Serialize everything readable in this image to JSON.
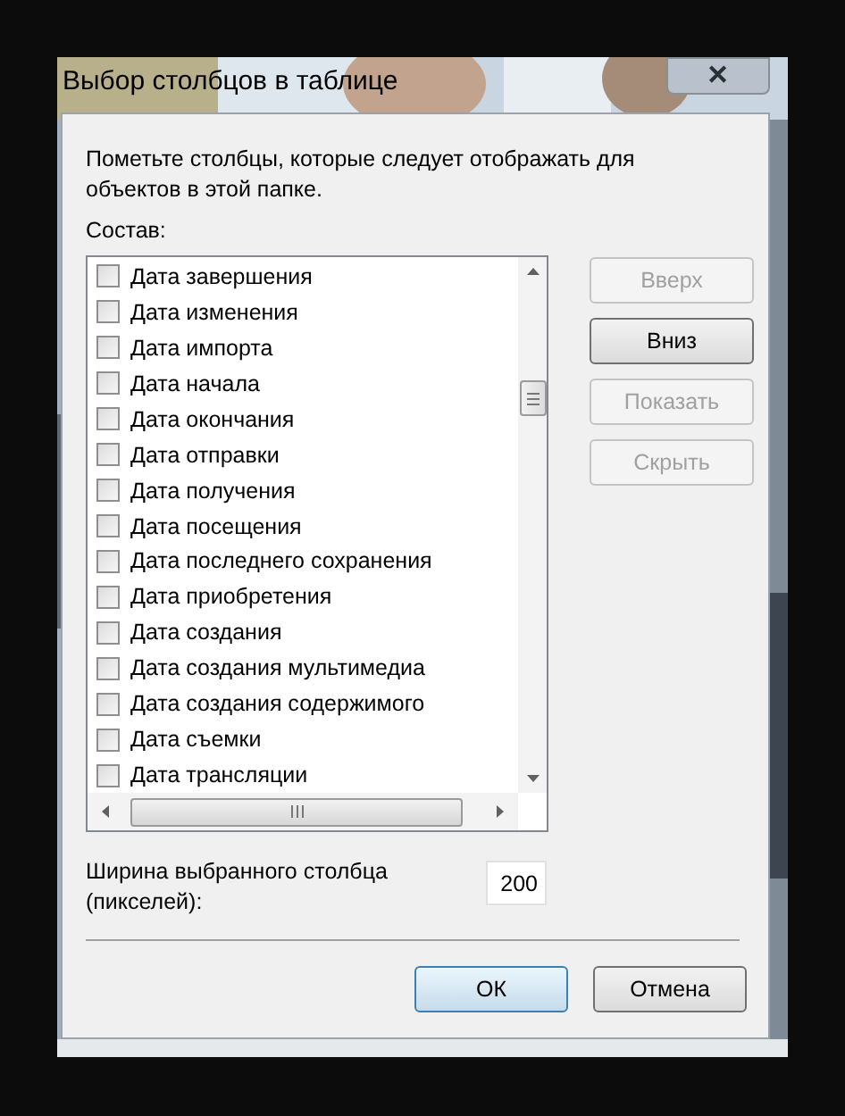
{
  "window": {
    "title": "Выбор столбцов в таблице",
    "close": "✕"
  },
  "instructions": "Пометьте столбцы, которые следует отображать для объектов в этой папке.",
  "list_label": "Состав:",
  "columns": [
    {
      "label": "Дата завершения",
      "checked": false
    },
    {
      "label": "Дата изменения",
      "checked": false
    },
    {
      "label": "Дата импорта",
      "checked": false
    },
    {
      "label": "Дата начала",
      "checked": false
    },
    {
      "label": "Дата окончания",
      "checked": false
    },
    {
      "label": "Дата отправки",
      "checked": false
    },
    {
      "label": "Дата получения",
      "checked": false
    },
    {
      "label": "Дата посещения",
      "checked": false
    },
    {
      "label": "Дата последнего сохранения",
      "checked": false
    },
    {
      "label": "Дата приобретения",
      "checked": false
    },
    {
      "label": "Дата создания",
      "checked": false
    },
    {
      "label": "Дата создания мультимедиа",
      "checked": false
    },
    {
      "label": "Дата создания содержимого",
      "checked": false
    },
    {
      "label": "Дата съемки",
      "checked": false
    },
    {
      "label": "Дата трансляции",
      "checked": false
    }
  ],
  "side_buttons": [
    {
      "label": "Вверх",
      "disabled": true
    },
    {
      "label": "Вниз",
      "disabled": false
    },
    {
      "label": "Показать",
      "disabled": true
    },
    {
      "label": "Скрыть",
      "disabled": true
    }
  ],
  "width_label": "Ширина выбранного столбца (пикселей):",
  "width_value": "200",
  "buttons": [
    {
      "label": "ОК",
      "kind": "default"
    },
    {
      "label": "Отмена",
      "kind": "normal"
    }
  ]
}
